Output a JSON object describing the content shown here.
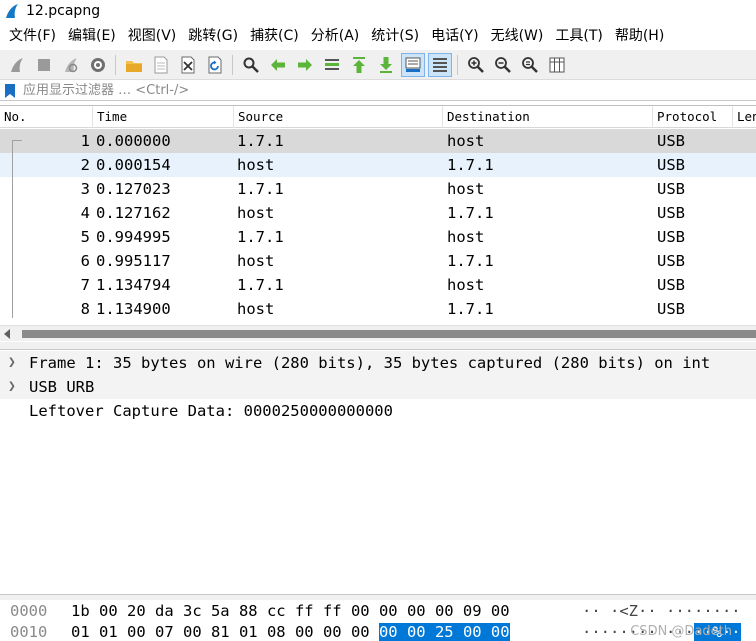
{
  "window": {
    "title": "12.pcapng"
  },
  "menu": [
    "文件(F)",
    "编辑(E)",
    "视图(V)",
    "跳转(G)",
    "捕获(C)",
    "分析(A)",
    "统计(S)",
    "电话(Y)",
    "无线(W)",
    "工具(T)",
    "帮助(H)"
  ],
  "toolbar": {
    "icons": [
      "shark-fin-start-icon",
      "stop-square-icon",
      "restart-fin-icon",
      "capture-options-gear-icon",
      "open-folder-icon",
      "save-file-icon",
      "close-file-icon",
      "reload-icon",
      "find-magnifier-icon",
      "go-back-arrow-icon",
      "go-forward-arrow-icon",
      "go-to-packet-icon",
      "go-first-icon",
      "go-last-icon",
      "autoscroll-icon",
      "colorize-icon",
      "zoom-in-icon",
      "zoom-out-icon",
      "zoom-normal-icon",
      "resize-columns-icon"
    ]
  },
  "filter": {
    "placeholder": "应用显示过滤器 … <Ctrl-/>"
  },
  "packet_list": {
    "columns": [
      "No.",
      "Time",
      "Source",
      "Destination",
      "Protocol",
      "Len"
    ],
    "rows": [
      {
        "no": "1",
        "time": "0.000000",
        "source": "1.7.1",
        "destination": "host",
        "protocol": "USB"
      },
      {
        "no": "2",
        "time": "0.000154",
        "source": "host",
        "destination": "1.7.1",
        "protocol": "USB"
      },
      {
        "no": "3",
        "time": "0.127023",
        "source": "1.7.1",
        "destination": "host",
        "protocol": "USB"
      },
      {
        "no": "4",
        "time": "0.127162",
        "source": "host",
        "destination": "1.7.1",
        "protocol": "USB"
      },
      {
        "no": "5",
        "time": "0.994995",
        "source": "1.7.1",
        "destination": "host",
        "protocol": "USB"
      },
      {
        "no": "6",
        "time": "0.995117",
        "source": "host",
        "destination": "1.7.1",
        "protocol": "USB"
      },
      {
        "no": "7",
        "time": "1.134794",
        "source": "1.7.1",
        "destination": "host",
        "protocol": "USB"
      },
      {
        "no": "8",
        "time": "1.134900",
        "source": "host",
        "destination": "1.7.1",
        "protocol": "USB"
      }
    ]
  },
  "details": [
    {
      "text": "Frame 1: 35 bytes on wire (280 bits), 35 bytes captured (280 bits) on int",
      "expandable": true
    },
    {
      "text": "USB URB",
      "expandable": true
    },
    {
      "text": "Leftover Capture Data: 0000250000000000",
      "expandable": false
    }
  ],
  "bytes": [
    {
      "offset": "0000",
      "hex_plain": "1b 00 20 da 3c 5a 88 cc  ff ff 00 00 00 00 09 00",
      "hex_hl": "",
      "ascii_plain": "·· ·<Z··  ········",
      "ascii_hl": ""
    },
    {
      "offset": "0010",
      "hex_plain": "01 01 00 07 00 81 01 08  00 00 00 ",
      "hex_hl": "00 00 25 00 00",
      "ascii_plain": "········ ···",
      "ascii_hl": "··%··"
    }
  ],
  "watermark": "CSDN @Dadeth"
}
